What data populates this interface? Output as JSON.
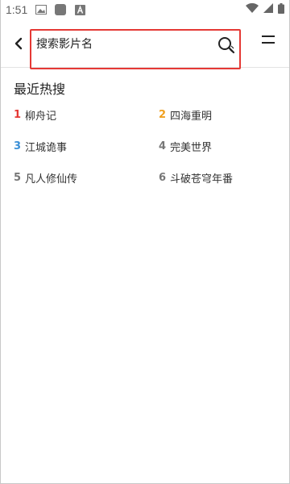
{
  "status_bar": {
    "time": "1:51",
    "icons": [
      "image-icon",
      "app-square-icon",
      "a-icon",
      "wifi-icon",
      "signal-icon",
      "battery-icon"
    ]
  },
  "search": {
    "placeholder": "搜索影片名",
    "value": "",
    "icon": "search-icon",
    "highlight_color": "#e53935"
  },
  "hot": {
    "title": "最近热搜",
    "items": [
      {
        "rank": "1",
        "name": "柳舟记",
        "color": "#e53935"
      },
      {
        "rank": "2",
        "name": "四海重明",
        "color": "#f0a020"
      },
      {
        "rank": "3",
        "name": "江城诡事",
        "color": "#3a8fd6"
      },
      {
        "rank": "4",
        "name": "完美世界",
        "color": "#777777"
      },
      {
        "rank": "5",
        "name": "凡人修仙传",
        "color": "#777777"
      },
      {
        "rank": "6",
        "name": "斗破苍穹年番",
        "color": "#777777"
      }
    ]
  }
}
